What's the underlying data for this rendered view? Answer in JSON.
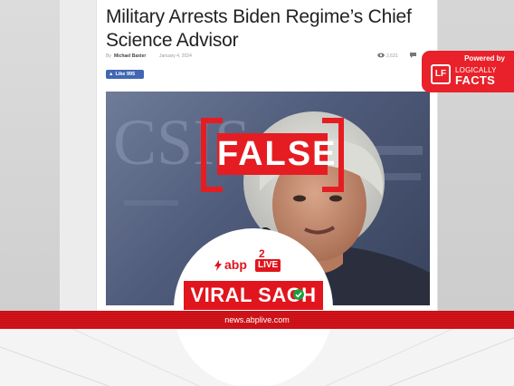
{
  "article": {
    "headline": "Military Arrests Biden Regime’s Chief Science Advisor",
    "byline_prefix": "By",
    "author": "Michael Baxter",
    "date": "January 4, 2024",
    "views": "2,631",
    "like_label": "Like 995"
  },
  "photo": {
    "backdrop_text": "CSIS"
  },
  "fact_check": {
    "verdict": "FALSE",
    "color": "#e51d23"
  },
  "partner": {
    "powered_by": "Powered by",
    "logo_mark": "LF",
    "brand_top": "LOGICALLY",
    "brand_bottom": "FACTS",
    "color": "#e8212a"
  },
  "publisher": {
    "logo": "abp",
    "live_label": "LIVE",
    "superscript": "2",
    "show_name": "VIRAL SACH",
    "website": "news.abplive.com",
    "color": "#e0151d"
  },
  "icons": [
    "eye-icon",
    "comment-icon",
    "thumbs-up-icon",
    "bolt-icon",
    "check-icon"
  ]
}
